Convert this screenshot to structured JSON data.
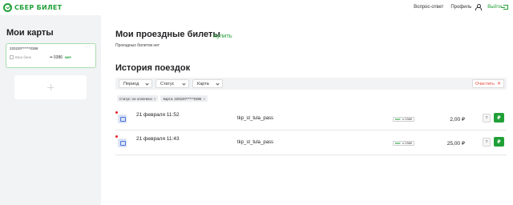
{
  "header": {
    "logo_text": "СБЕР БИЛЕТ",
    "nav_faq": "Вопрос-ответ",
    "nav_profile": "Профиль",
    "nav_logout": "Выйти"
  },
  "sidebar": {
    "title": "Мои карты",
    "card": {
      "number": "220220******0386",
      "menu": "···",
      "bank": "Ваш банк",
      "mask": "•• 0386",
      "payment_system": "МИР"
    }
  },
  "main": {
    "title": "Мои проездные билеты",
    "buy_label": "Купить",
    "no_tickets": "Проездных билетов нет",
    "history_title": "История поездок",
    "filters": {
      "period": "Период",
      "status": "Статус",
      "card": "Карта",
      "clear": "Очистить"
    },
    "chips": [
      {
        "label": "Статус: не оплачено"
      },
      {
        "label": "Карта: 220220******0386"
      }
    ],
    "trips": [
      {
        "date": "21 февраля 11:52",
        "route": "tkp_st_tula_pass",
        "card_mask": "•• 0386",
        "payment_system": "МИР",
        "amount": "2,00 ₽",
        "help_label": "?",
        "pay_label": "₽"
      },
      {
        "date": "21 февраля 11:43",
        "route": "tkp_st_tula_pass",
        "card_mask": "•• 0386",
        "payment_system": "МИР",
        "amount": "25,00 ₽",
        "help_label": "?",
        "pay_label": "₽"
      }
    ]
  },
  "colors": {
    "brand": "#21a038",
    "danger": "#e5483b",
    "sidebar_bg": "#f2f3f5"
  }
}
